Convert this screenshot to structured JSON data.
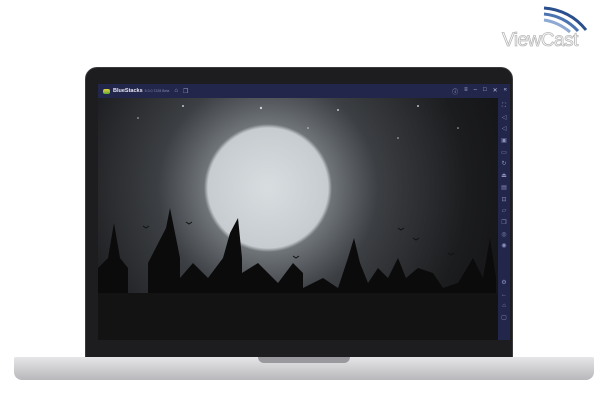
{
  "watermark": {
    "brand": "ViewCast"
  },
  "app": {
    "name": "BlueStacks",
    "version": "5.0.0.7228 Beta"
  },
  "titlebar": {
    "icons": [
      "home-icon",
      "multi-instance-icon"
    ],
    "controls": [
      "help-icon",
      "menu-icon",
      "minimize-icon",
      "maximize-icon",
      "close-icon",
      "collapse-sidebar-icon"
    ]
  },
  "sidebar": {
    "items": [
      "fullscreen-icon",
      "volume-up-icon",
      "volume-down-icon",
      "screen-record-icon",
      "tv-icon",
      "rotate-icon",
      "install-apk-icon",
      "media-folder-icon",
      "screenshot-icon",
      "folder-icon",
      "multi-instance-icon",
      "eco-mode-icon",
      "macro-icon",
      "settings-icon",
      "back-icon",
      "home-icon",
      "recent-apps-icon"
    ]
  },
  "colors": {
    "chrome": "#22264a",
    "accent": "#e8d33a"
  }
}
